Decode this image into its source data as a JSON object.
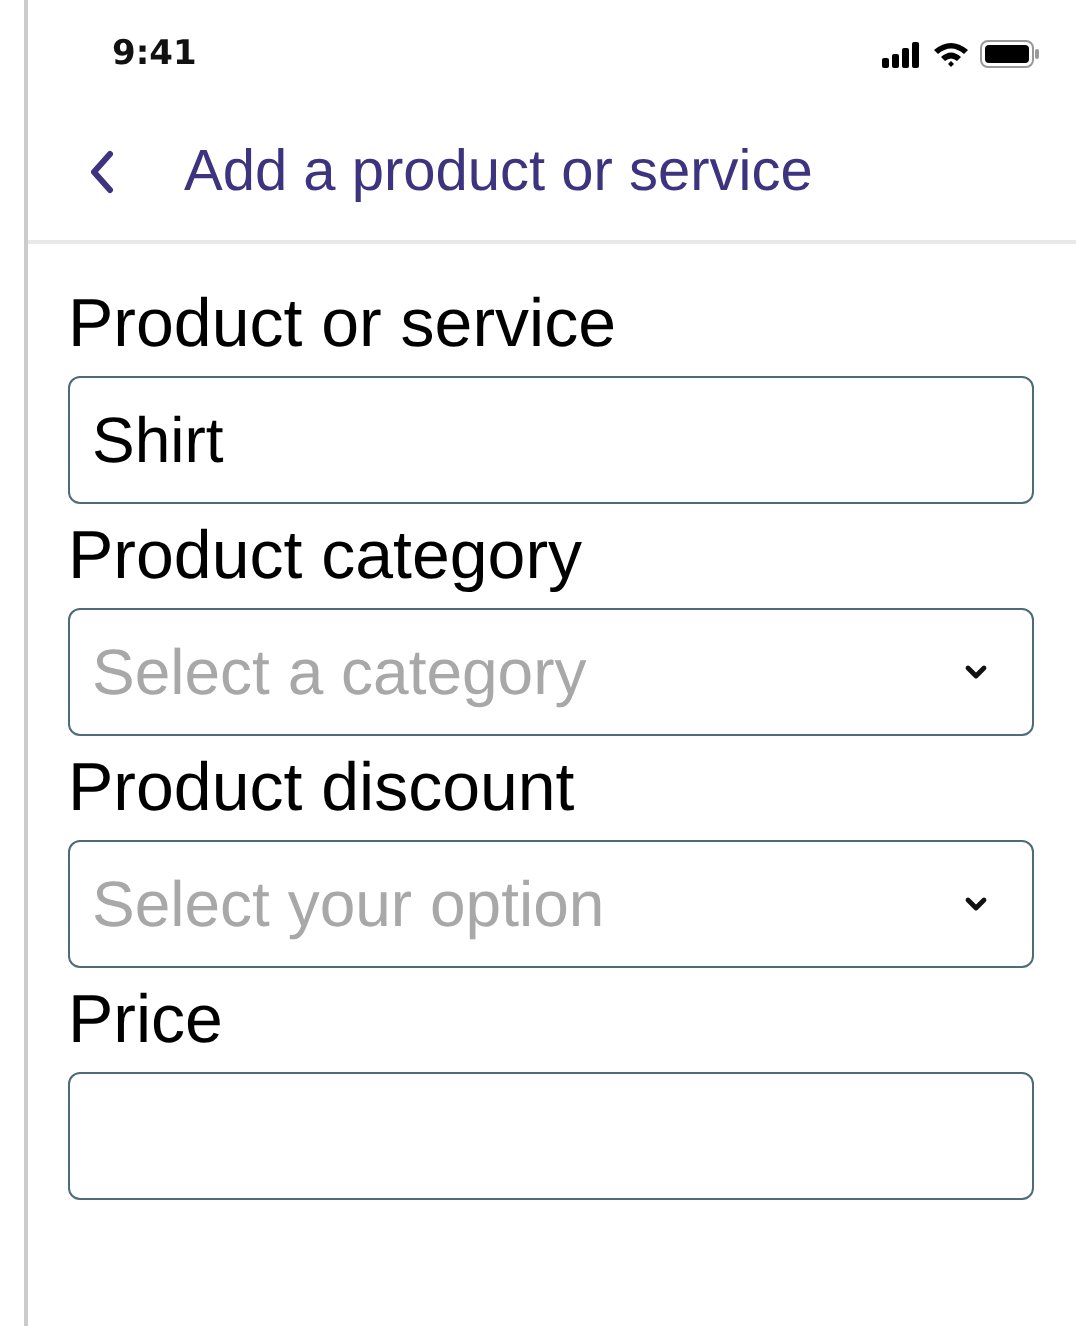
{
  "status_bar": {
    "time": "9:41"
  },
  "header": {
    "title": "Add a product or service"
  },
  "fields": [
    {
      "kind": "text",
      "label": "Product or service",
      "value": "Shirt"
    },
    {
      "kind": "select",
      "label": "Product category",
      "placeholder": "Select a category"
    },
    {
      "kind": "select",
      "label": "Product discount",
      "placeholder": "Select your option"
    },
    {
      "kind": "text",
      "label": "Price"
    }
  ]
}
